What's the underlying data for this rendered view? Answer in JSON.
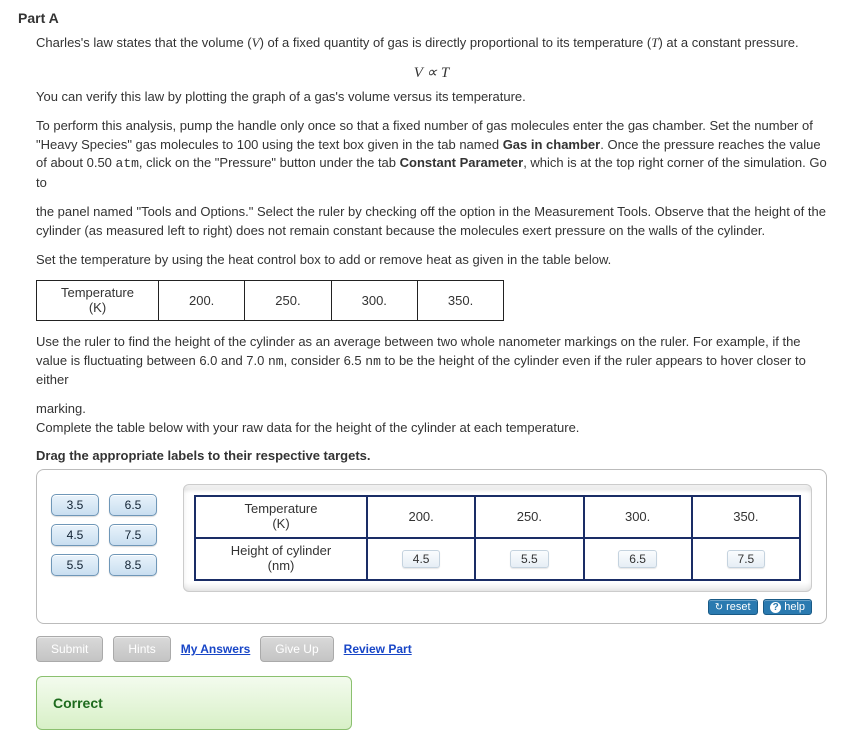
{
  "part_title": "Part A",
  "para1_pre": "Charles's law states that the volume (",
  "var_V": "V",
  "para1_mid": ") of a fixed quantity of gas is directly proportional to its temperature (",
  "var_T": "T",
  "para1_post": ") at a constant pressure.",
  "equation": "V ∝ T",
  "para2": "You can verify this law by plotting the graph of a gas's volume versus its temperature.",
  "para3_a": "To perform this analysis, pump the handle only once so that a fixed number of gas molecules enter the gas chamber. Set the number of \"Heavy Species\" gas molecules to 100 using the text box given in the tab named ",
  "para3_b_bold": "Gas in chamber",
  "para3_c": ". Once the pressure reaches the value of about 0.50 ",
  "para3_atm": "atm",
  "para3_d": ", click on the \"Pressure\" button under the tab ",
  "para3_e_bold": "Constant Parameter",
  "para3_f": ", which is at the top right corner of the simulation. Go to",
  "para4": "the panel named \"Tools and Options.\" Select the ruler by checking off the option in the Measurement Tools. Observe that the height of the cylinder (as measured left to right) does not remain constant because the molecules exert pressure on the walls of the cylinder.",
  "para5": "Set the temperature by using the heat control box to add or remove heat as given in the table below.",
  "temp_table": {
    "header_line1": "Temperature",
    "header_line2": "(K)",
    "values": [
      "200.",
      "250.",
      "300.",
      "350."
    ]
  },
  "para6_a": "Use the ruler to find the height of the cylinder as an average between two whole nanometer markings on the ruler. For example, if the value is fluctuating between 6.0 and 7.0 ",
  "para6_nm": "nm",
  "para6_b": ", consider 6.5 ",
  "para6_nm2": "nm",
  "para6_c": " to be the height of the cylinder even if the ruler appears to hover closer to either",
  "para7": "marking.\nComplete the table below with your raw data for the height of the cylinder at each temperature.",
  "drag_instruction": "Drag the appropriate labels to their respective targets.",
  "tiles": [
    "3.5",
    "6.5",
    "4.5",
    "7.5",
    "5.5",
    "8.5"
  ],
  "target_table": {
    "row1_label_line1": "Temperature",
    "row1_label_line2": "(K)",
    "row1_values": [
      "200.",
      "250.",
      "300.",
      "350."
    ],
    "row2_label_line1": "Height of cylinder",
    "row2_label_line2": "(nm)",
    "row2_values": [
      "4.5",
      "5.5",
      "6.5",
      "7.5"
    ]
  },
  "reset_label": "reset",
  "help_label": "help",
  "actions": {
    "submit": "Submit",
    "hints": "Hints",
    "my_answers": "My Answers",
    "give_up": "Give Up",
    "review": "Review Part"
  },
  "feedback": "Correct"
}
